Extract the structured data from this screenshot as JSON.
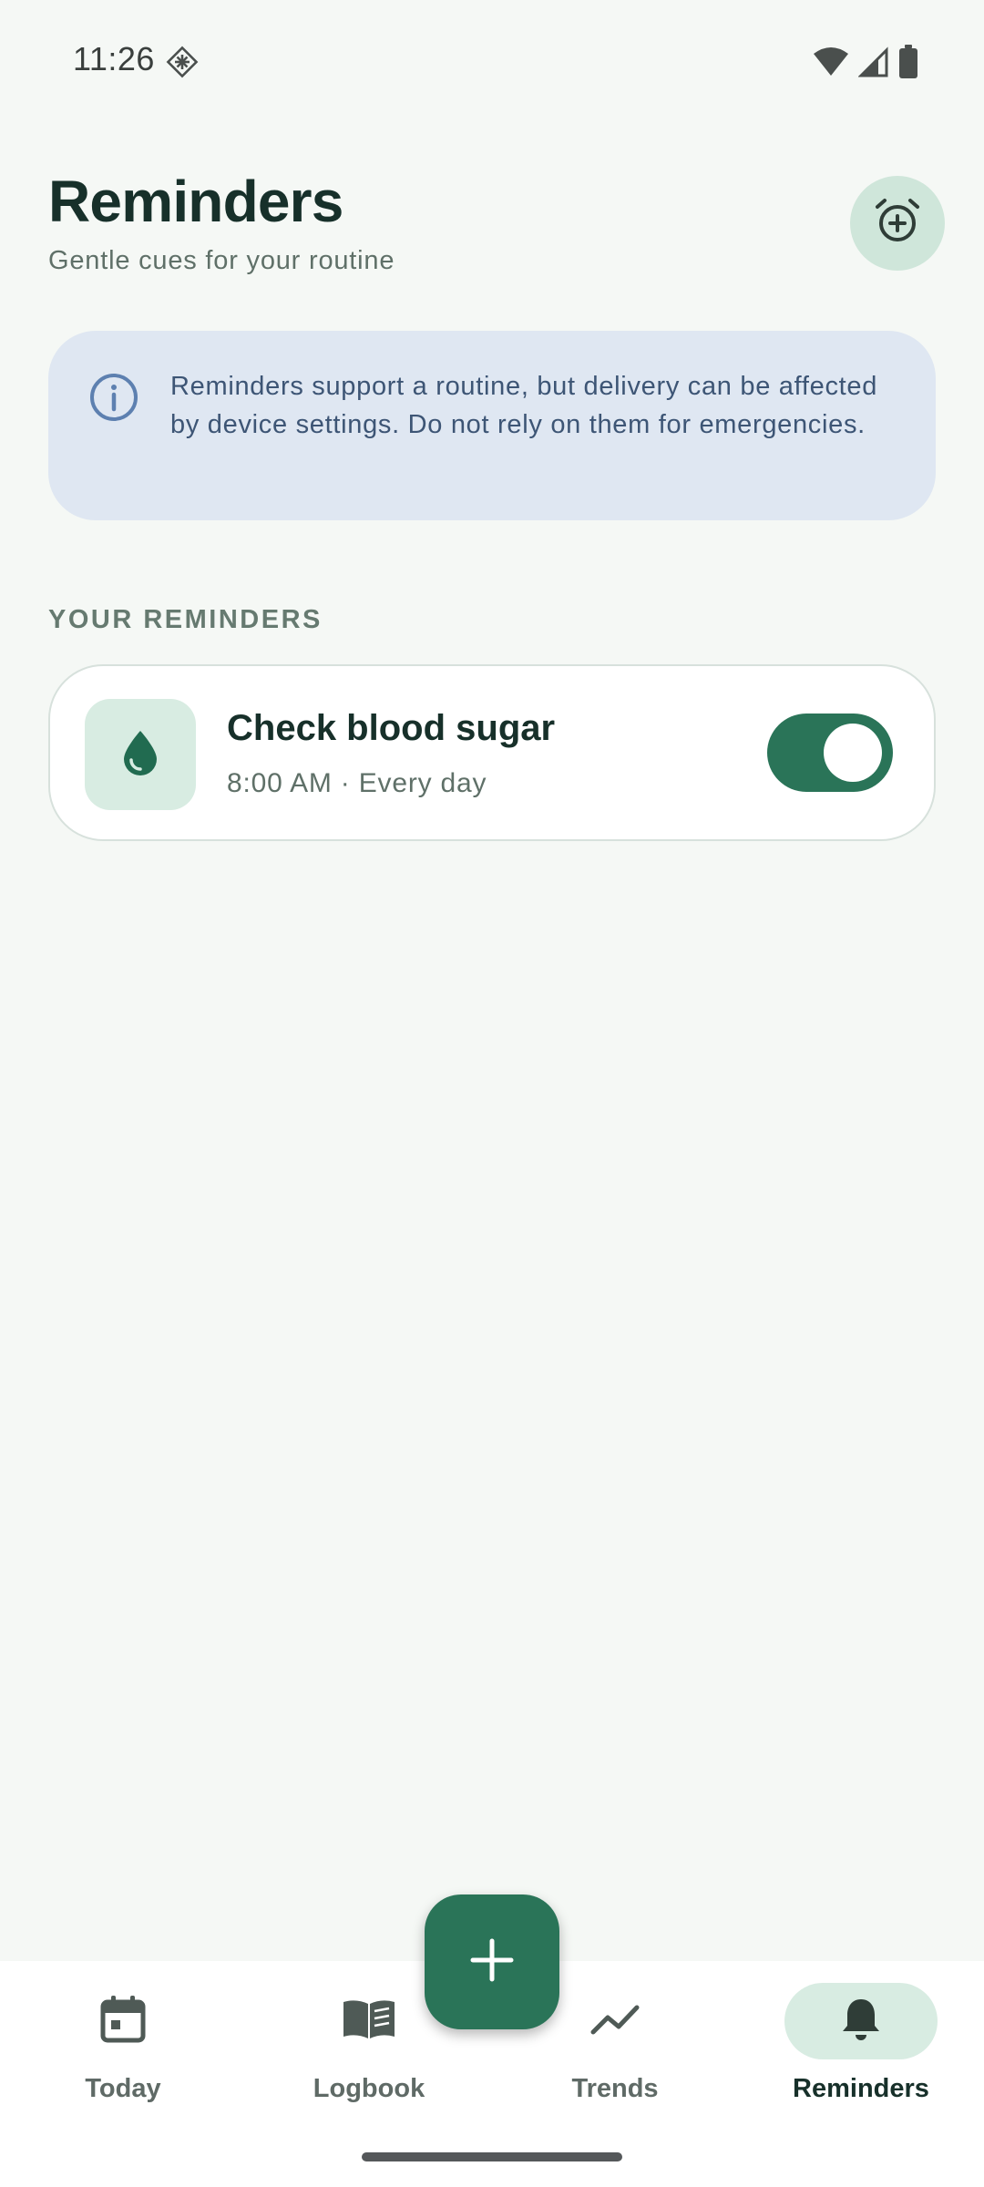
{
  "status_bar": {
    "time": "11:26",
    "icons": [
      "notification-diamond-icon",
      "wifi-icon",
      "cellular-signal-icon",
      "battery-icon"
    ]
  },
  "header": {
    "title": "Reminders",
    "subtitle": "Gentle cues for your routine",
    "add_button_icon": "alarm-add-icon"
  },
  "info_banner": {
    "icon": "info-icon",
    "text": "Reminders support a routine, but delivery can be affected by device settings. Do not rely on them for emergencies."
  },
  "section": {
    "heading": "YOUR REMINDERS"
  },
  "reminders": [
    {
      "icon": "water-drop-icon",
      "title": "Check blood sugar",
      "meta": "8:00 AM · Every day",
      "enabled": true
    }
  ],
  "bottom_nav": {
    "items": [
      {
        "label": "Today",
        "icon": "calendar-icon",
        "active": false
      },
      {
        "label": "Logbook",
        "icon": "book-icon",
        "active": false
      },
      {
        "label": "Trends",
        "icon": "trend-line-icon",
        "active": false
      },
      {
        "label": "Reminders",
        "icon": "bell-icon",
        "active": true
      }
    ]
  },
  "fab": {
    "icon": "plus-icon"
  },
  "colors": {
    "background": "#f5f8f5",
    "primary": "#2a7458",
    "primary_container": "#cfe6da",
    "info_container": "#dfe7f2",
    "text_primary": "#17302a",
    "text_secondary": "#5f7068"
  }
}
